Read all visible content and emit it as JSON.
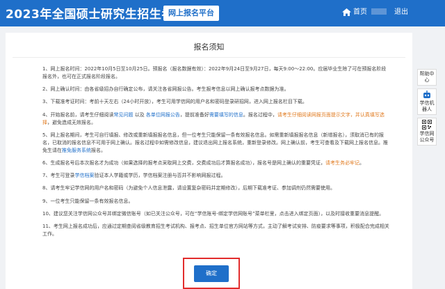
{
  "header": {
    "title": "2023年全国硕士研究生招生考试",
    "platform_label": "网上报名平台",
    "home_label": "首页",
    "logout_label": "退出"
  },
  "panel": {
    "title": "报名须知",
    "confirm_label": "确定"
  },
  "notices": {
    "n1": {
      "t": "1、网上报名时间：2022年10月5日至10月25日。预报名（报名数据有效）：2022年9月24日至9月27日，每天9:00～22:00。应届毕业生除了可在预报名阶段报名外，也可在正式报名阶段报名。"
    },
    "n2": {
      "t": "2、网上确认时间：由各省级招办自行确定公布，请关注各省网报公告。考生报考信息以网上确认报考点数据为准。"
    },
    "n3": {
      "t": "3、下载准考证时间：考前十天左右（24小时开放），考生可用学信网的用户名和密码登录研招网，进入网上报名栏目下载。"
    },
    "n4": {
      "a": "4、开始报名前，请考生仔细阅读",
      "b": "常见问题",
      "c": " 以及 ",
      "d": "各单位网报公告",
      "e": "，提前准备好",
      "f": "需要填写的信息",
      "g": "。报名过程中，",
      "h": "请考生仔细阅读网报页面提示文字，并认真填写选择",
      "i": "，避免造成无效报名。"
    },
    "n5": {
      "a": "5、网上报名期间，考生可自行填报、修改或重新填报报名信息，但一位考生只能保留一条有效报名信息。如需重新填报报名信息（新增报名），须取消已有的报名，已取消的报名信息不可用于网上确认。报名过程中如需修改信息，建议退出网上报名系统，重新登录修改。网上确认前，考生可查看及下载网上报名信息。推免生请在",
      "b": "推免服务系统",
      "c": "报名。"
    },
    "n6": {
      "a": "6、生成报名号后本次报名才为成功（如果选择的报考点采取网上交费，交费成功后才算报名成功），报名号是网上确认的重要凭证，",
      "b": "请考生务必牢记",
      "c": "。"
    },
    "n7": {
      "a": "7、考生可登录",
      "b": "学信档案",
      "c": "验证本人学籍或学历，学信档案注册与否并不影响网报过程。"
    },
    "n8": {
      "t": "8、请考生牢记学信网的用户名和密码（为避免个人信息泄露，请设置复杂密码并定期修改），后期下载准考证、参加调剂仍然需要使用。"
    },
    "n9": {
      "t": "9、一位考生只能保留一条有效报名信息。"
    },
    "n10": {
      "t": "10、建议您关注学信网公众号并绑定微信账号（如已关注公众号，可在“学信账号-绑定学信网账号”菜单栏里，点击进入绑定页面），以及时接收重要消息提醒。"
    },
    "n11": {
      "t": "11、考生网上报名成功后，应通过定期查阅省级教育招生考试机构、报考点、招生单位官方网站等方式，主动了解考试安排、防疫要求等事项，积极配合完成相关工作。"
    }
  },
  "sidebar": {
    "help_label": "帮助中心",
    "robot_label": "学信机器人",
    "wechat_label": "学信网公众号"
  },
  "colors": {
    "brand": "#1f6fc9",
    "highlight": "#e07a1f",
    "outline": "#e22c2c"
  },
  "icons": [
    "home-icon",
    "robot-icon",
    "qr-code-icon"
  ]
}
